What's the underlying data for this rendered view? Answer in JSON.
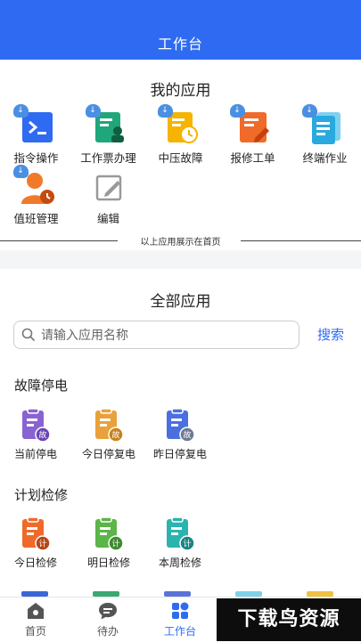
{
  "header": {
    "title": "工作台"
  },
  "my_apps": {
    "title": "我的应用",
    "items": [
      {
        "label": "指令操作",
        "icon": "terminal-icon",
        "color": "#2f6bf2"
      },
      {
        "label": "工作票办理",
        "icon": "ticket-user-icon",
        "color": "#1fa67a"
      },
      {
        "label": "中压故障",
        "icon": "clock-doc-icon",
        "color": "#f4b400"
      },
      {
        "label": "报修工单",
        "icon": "doc-pen-icon",
        "color": "#f06a2a"
      },
      {
        "label": "终端作业",
        "icon": "doc-stack-icon",
        "color": "#29a9e0"
      },
      {
        "label": "值班管理",
        "icon": "person-clock-icon",
        "color": "#f07a2a"
      },
      {
        "label": "编辑",
        "icon": "edit-icon",
        "color": "#888888"
      }
    ],
    "footer_text": "以上应用展示在首页"
  },
  "all_apps": {
    "title": "全部应用",
    "search": {
      "placeholder": "请输入应用名称",
      "button": "搜索"
    },
    "groups": [
      {
        "title": "故障停电",
        "badge": "故",
        "items": [
          {
            "label": "当前停电",
            "color": "#8a63d2"
          },
          {
            "label": "今日停复电",
            "color": "#e9a23b"
          },
          {
            "label": "昨日停复电",
            "color": "#4a6fe0"
          }
        ]
      },
      {
        "title": "计划检修",
        "badge": "计",
        "items": [
          {
            "label": "今日检修",
            "color": "#ef6a2a"
          },
          {
            "label": "明日检修",
            "color": "#5bb548"
          },
          {
            "label": "本周检修",
            "color": "#2bb3b0"
          }
        ]
      }
    ]
  },
  "bottom_nav": {
    "items": [
      {
        "label": "首页",
        "icon": "home-icon"
      },
      {
        "label": "待办",
        "icon": "chat-icon"
      },
      {
        "label": "工作台",
        "icon": "grid-icon",
        "active": true
      }
    ]
  },
  "watermark": {
    "text": "下载鸟资源"
  }
}
